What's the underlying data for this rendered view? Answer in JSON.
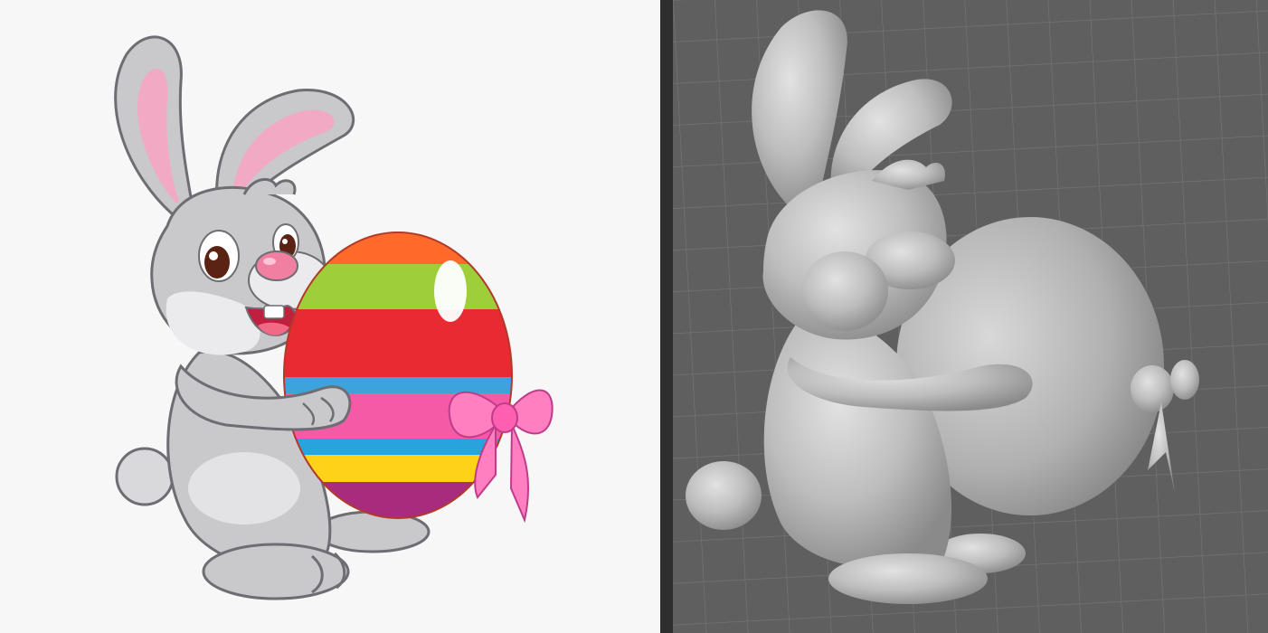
{
  "left_panel": {
    "kind": "cartoon-illustration",
    "subject": "bunny-holding-easter-egg",
    "colors": {
      "background": "#f7f7f7",
      "fur": "#c9c9cb",
      "fur_light": "#ebebee",
      "outline": "#6d6d73",
      "inner_ear": "#f2a9c4",
      "nose": "#f07fa2",
      "egg_stripes": [
        "#ff6a2a",
        "#9fce3b",
        "#e82a32",
        "#3ea2dd",
        "#f45aa6",
        "#29a3dc",
        "#ffd21a",
        "#a92b7e"
      ],
      "bow": "#ff7fc1"
    }
  },
  "right_panel": {
    "kind": "3d-model-render",
    "subject": "bunny-holding-easter-egg-relief",
    "colors": {
      "background": "#5f5f5f",
      "grid_lines": "#747474",
      "model": "#bdbdbd",
      "model_shadow": "#8a8a8a",
      "model_highlight": "#e2e2e2"
    }
  }
}
